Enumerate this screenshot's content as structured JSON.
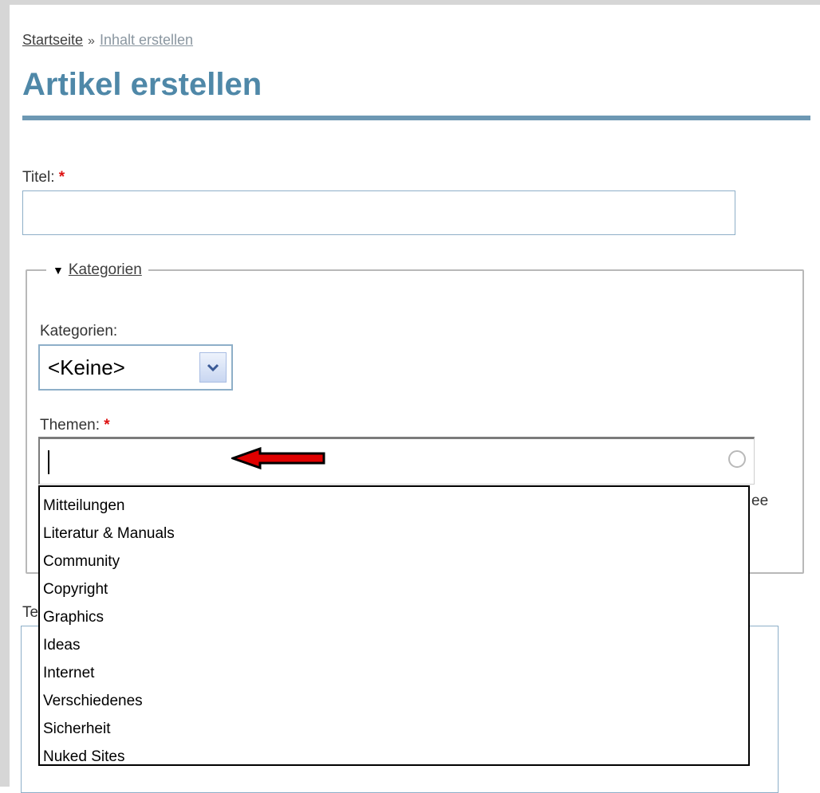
{
  "breadcrumb": {
    "home": "Startseite",
    "separator": "»",
    "current": "Inhalt erstellen"
  },
  "page": {
    "title": "Artikel erstellen"
  },
  "form": {
    "title_label": "Titel:",
    "title_value": "",
    "required_mark": "*",
    "fieldset": {
      "legend": "Kategorien",
      "toggle_icon": "triangle-down-icon"
    },
    "kategorien": {
      "label": "Kategorien:",
      "selected": "<Keine>",
      "button_icon": "chevron-down-icon"
    },
    "themen": {
      "label": "Themen:",
      "value": "",
      "status_icon": "throbber-icon",
      "suggestions": [
        "Mitteilungen",
        "Literatur & Manuals",
        "Community",
        "Copyright",
        "Graphics",
        "Ideas",
        "Internet",
        "Verschiedenes",
        "Sicherheit",
        "Nuked Sites"
      ]
    },
    "obscured": {
      "label_fragment": "Te",
      "help_fragment": "ee"
    }
  },
  "annotation": {
    "arrow_icon": "red-arrow-left-icon",
    "arrow_color": "#e00000"
  },
  "colors": {
    "heading": "#4f88a8",
    "rule": "#6d98b3",
    "input_border": "#8eafc8",
    "required": "#dd1111"
  }
}
